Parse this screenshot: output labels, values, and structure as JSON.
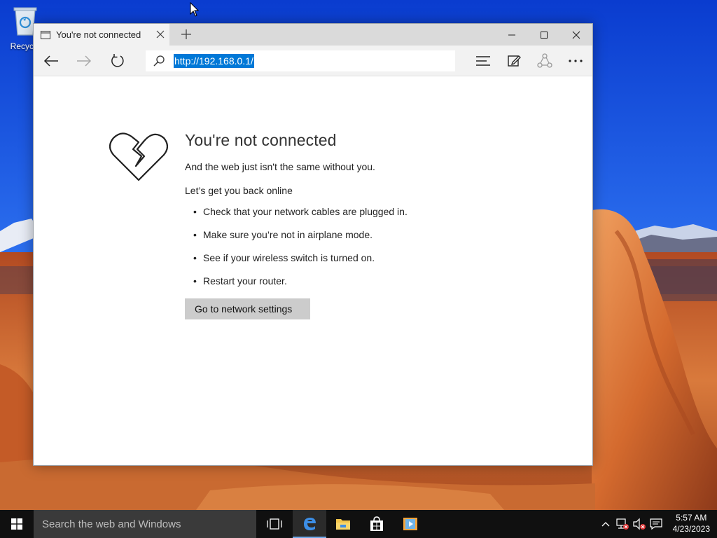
{
  "desktop": {
    "recycle_bin_label": "Recycle"
  },
  "browser": {
    "tab_title": "You're not connected",
    "address": "http://192.168.0.1/"
  },
  "error_page": {
    "heading": "You're not connected",
    "subtitle": "And the web just isn't the same without you.",
    "lead": "Let’s get you back online",
    "tips": [
      "Check that your network cables are plugged in.",
      "Make sure you’re not in airplane mode.",
      "See if your wireless switch is turned on.",
      "Restart your router."
    ],
    "button_label": "Go to network settings"
  },
  "taskbar": {
    "search_placeholder": "Search the web and Windows",
    "time": "5:57 AM",
    "date": "4/23/2023"
  },
  "colors": {
    "selection": "#0078d7",
    "edge_blue": "#3c8ee6",
    "taskbar_bg": "#101010"
  },
  "icons": {
    "titlebar": [
      "page-icon",
      "close-icon",
      "plus-icon",
      "minimize-icon",
      "maximize-icon",
      "close-icon"
    ],
    "navbar": [
      "back-arrow-icon",
      "forward-arrow-icon",
      "refresh-icon",
      "search-icon",
      "hub-icon",
      "web-note-icon",
      "share-icon",
      "more-icon"
    ],
    "taskbar": [
      "windows-logo-icon",
      "task-view-icon",
      "edge-icon",
      "file-explorer-icon",
      "store-icon",
      "media-app-icon",
      "chevron-up-icon",
      "network-icon",
      "volume-muted-icon",
      "action-center-icon"
    ]
  }
}
